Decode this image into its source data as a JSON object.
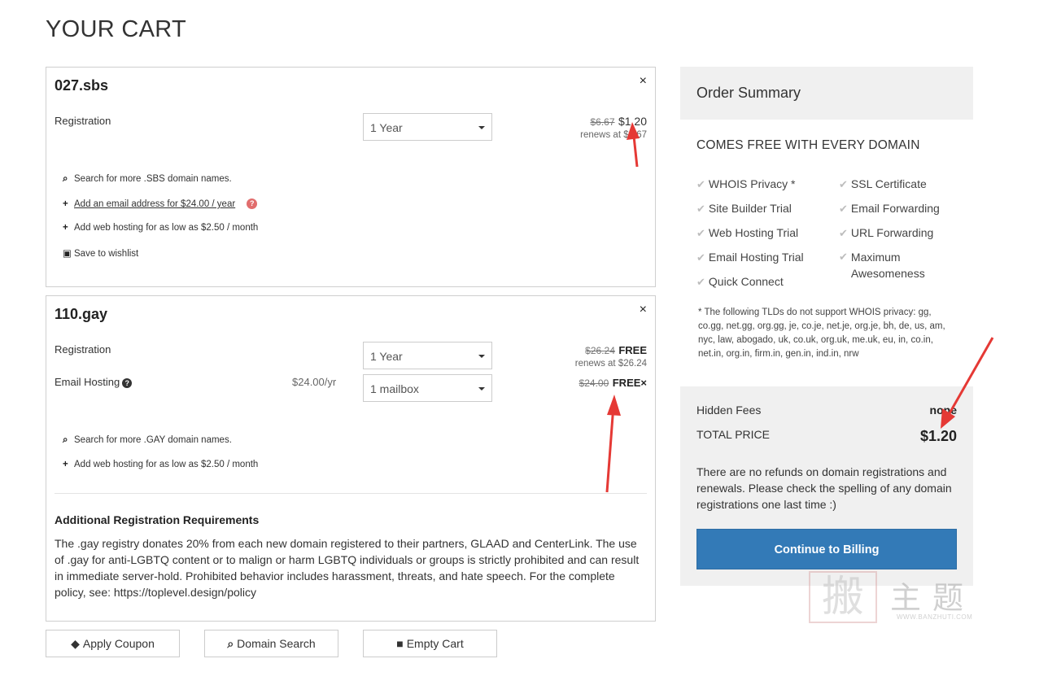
{
  "page": {
    "title": "YOUR CART"
  },
  "items": [
    {
      "domain": "027.sbs",
      "close": "×",
      "registration": {
        "label": "Registration",
        "select": "1 Year",
        "old_price": "$6.67",
        "new_price": "$1.20",
        "renews": "renews at $6.67"
      },
      "actions": [
        {
          "icon": "search-icon",
          "glyph": "🔍",
          "text": "Search for more .SBS domain names."
        },
        {
          "icon": "plus-icon",
          "glyph": "+",
          "text": "Add an email address for $24.00 / year",
          "help": "?"
        },
        {
          "icon": "plus-icon",
          "glyph": "+",
          "text": "Add web hosting for as low as $2.50 / month"
        },
        {
          "icon": "save-icon",
          "glyph": "💾",
          "text": "Save to wishlist"
        }
      ]
    },
    {
      "domain": "110.gay",
      "close": "×",
      "registration": {
        "label": "Registration",
        "select": "1 Year",
        "old_price": "$26.24",
        "new_price": "FREE",
        "renews": "renews at $26.24"
      },
      "email_hosting": {
        "label": "Email Hosting",
        "help": "?",
        "price": "$24.00/yr",
        "select": "1 mailbox",
        "old_price": "$24.00",
        "new_price": "FREE",
        "remove": "×"
      },
      "actions": [
        {
          "icon": "search-icon",
          "text": "Search for more .GAY domain names."
        },
        {
          "icon": "plus-icon",
          "text": "Add web hosting for as low as $2.50 / month"
        }
      ],
      "requirements": {
        "title": "Additional Registration Requirements",
        "text": "The .gay registry donates 20% from each new domain registered to their partners, GLAAD and CenterLink. The use of .gay for anti-LGBTQ content or to malign or harm LGBTQ individuals or groups is strictly prohibited and can result in immediate server-hold. Prohibited behavior includes harassment, threats, and hate speech. For the complete policy, see: https://toplevel.design/policy"
      }
    }
  ],
  "buttons": {
    "apply_coupon": "Apply Coupon",
    "domain_search": "Domain Search",
    "empty_cart": "Empty Cart"
  },
  "summary": {
    "title": "Order Summary",
    "free_title": "COMES FREE WITH EVERY DOMAIN",
    "features_left": [
      "WHOIS Privacy *",
      "Site Builder Trial",
      "Web Hosting Trial",
      "Email Hosting Trial",
      "Quick Connect"
    ],
    "features_right": [
      "SSL Certificate",
      "Email Forwarding",
      "URL Forwarding",
      "Maximum Awesomeness"
    ],
    "note": "* The following TLDs do not support WHOIS privacy: gg, co.gg, net.gg, org.gg, je, co.je, net.je, org.je, bh, de, us, am, nyc, law, abogado, uk, co.uk, org.uk, me.uk, eu, in, co.in, net.in, org.in, firm.in, gen.in, ind.in, nrw",
    "hidden_fees_label": "Hidden Fees",
    "hidden_fees_value": "none",
    "total_label": "TOTAL PRICE",
    "total_value": "$1.20",
    "refund_text": "There are no refunds on domain registrations and renewals. Please check the spelling of any domain registrations one last time :)",
    "billing_button": "Continue to Billing"
  },
  "watermark": {
    "big_char": "搬",
    "chars": "主题",
    "site": "WWW.BANZHUTI.COM"
  },
  "colors": {
    "primary_button": "#337ab7",
    "annotation_arrow": "#e53935",
    "panel_bg": "#f0f0f0"
  }
}
